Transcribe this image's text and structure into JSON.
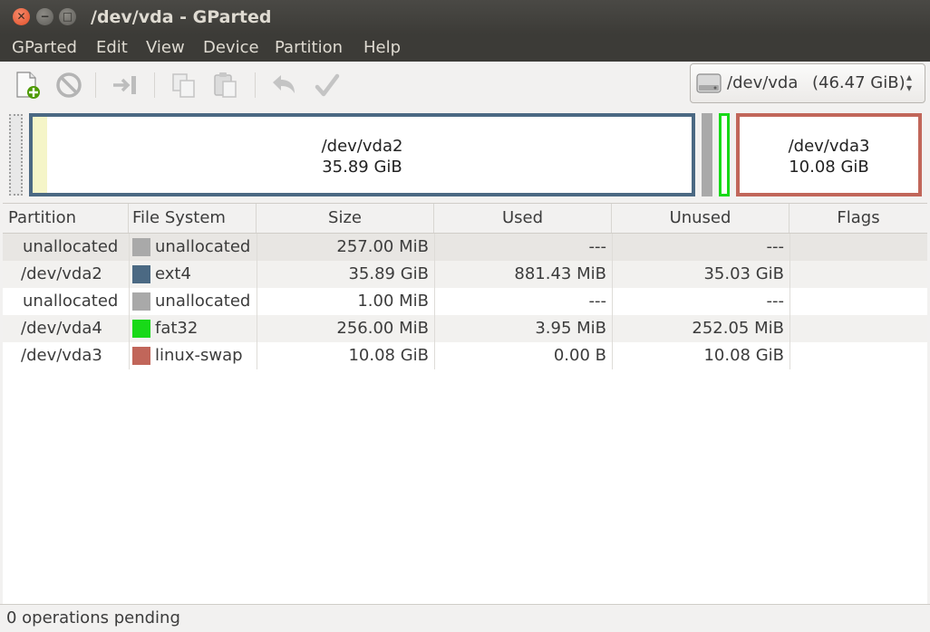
{
  "window": {
    "title": "/dev/vda - GParted"
  },
  "menu": [
    "GParted",
    "Edit",
    "View",
    "Device",
    "Partition",
    "Help"
  ],
  "toolbar": {
    "buttons": [
      "new-partition",
      "delete-partition",
      "resize-move-partition",
      "copy-partition",
      "paste-partition",
      "undo",
      "apply"
    ]
  },
  "device": {
    "name": "/dev/vda",
    "size": "(46.47 GiB)"
  },
  "map": {
    "vda2": {
      "name": "/dev/vda2",
      "size": "35.89 GiB"
    },
    "vda3": {
      "name": "/dev/vda3",
      "size": "10.08 GiB"
    }
  },
  "table": {
    "headers": [
      "Partition",
      "File System",
      "Size",
      "Used",
      "Unused",
      "Flags"
    ],
    "rows": [
      {
        "partition": "unallocated",
        "fs": "unallocated",
        "fs_color": "#a9a9a9",
        "size": "257.00 MiB",
        "used": "---",
        "unused": "---",
        "flags": ""
      },
      {
        "partition": "/dev/vda2",
        "fs": "ext4",
        "fs_color": "#4b6983",
        "size": "35.89 GiB",
        "used": "881.43 MiB",
        "unused": "35.03 GiB",
        "flags": ""
      },
      {
        "partition": "unallocated",
        "fs": "unallocated",
        "fs_color": "#a9a9a9",
        "size": "1.00 MiB",
        "used": "---",
        "unused": "---",
        "flags": ""
      },
      {
        "partition": "/dev/vda4",
        "fs": "fat32",
        "fs_color": "#18d918",
        "size": "256.00 MiB",
        "used": "3.95 MiB",
        "unused": "252.05 MiB",
        "flags": ""
      },
      {
        "partition": "/dev/vda3",
        "fs": "linux-swap",
        "fs_color": "#c1665a",
        "size": "10.08 GiB",
        "used": "0.00 B",
        "unused": "10.08 GiB",
        "flags": ""
      }
    ]
  },
  "status": {
    "text": "0 operations pending"
  },
  "colors": {
    "ext4": "#4b6983",
    "fat32": "#18d918",
    "linux_swap": "#c1665a",
    "unallocated": "#a9a9a9"
  }
}
